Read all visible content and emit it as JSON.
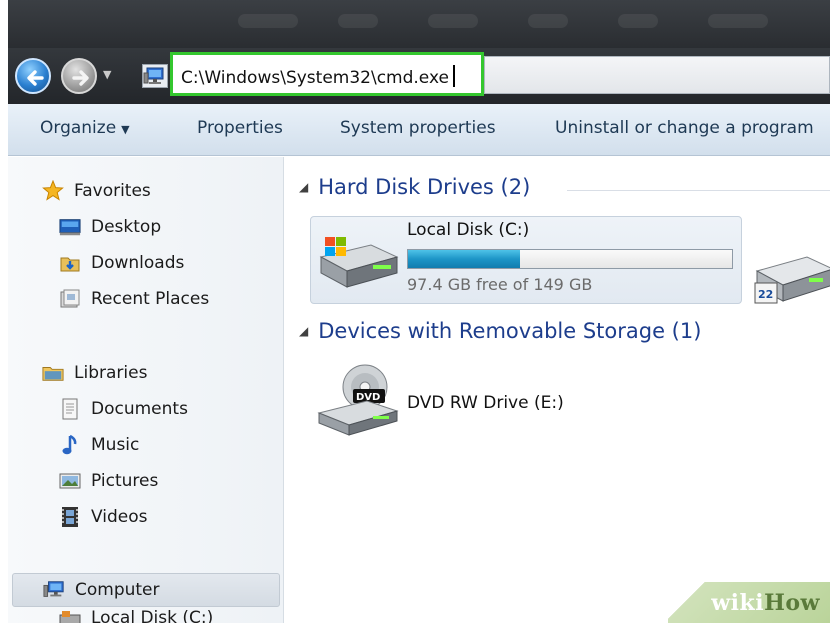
{
  "address_bar": {
    "path": "C:\\Windows\\System32\\cmd.exe",
    "history_arrow": "▼"
  },
  "toolbar": {
    "items": [
      {
        "label": "Organize",
        "dropdown": "▼"
      },
      {
        "label": "Properties"
      },
      {
        "label": "System properties"
      },
      {
        "label": "Uninstall or change a program"
      }
    ]
  },
  "navigation": {
    "favorites": {
      "label": "Favorites",
      "items": [
        {
          "label": "Desktop",
          "icon": "desktop-icon"
        },
        {
          "label": "Downloads",
          "icon": "downloads-icon"
        },
        {
          "label": "Recent Places",
          "icon": "recent-places-icon"
        }
      ]
    },
    "libraries": {
      "label": "Libraries",
      "items": [
        {
          "label": "Documents",
          "icon": "documents-icon"
        },
        {
          "label": "Music",
          "icon": "music-icon"
        },
        {
          "label": "Pictures",
          "icon": "pictures-icon"
        },
        {
          "label": "Videos",
          "icon": "videos-icon"
        }
      ]
    },
    "computer": {
      "label": "Computer",
      "selected": true,
      "child_partial": "Local Disk (C:)"
    }
  },
  "content": {
    "groups": [
      {
        "title": "Hard Disk Drives (2)",
        "drives": [
          {
            "name": "Local Disk (C:)",
            "free_text": "97.4 GB free of 149 GB",
            "used_fraction": 0.346
          }
        ]
      },
      {
        "title": "Devices with Removable Storage (1)",
        "drives": [
          {
            "name": "DVD RW Drive (E:)",
            "badge": "DVD"
          }
        ]
      }
    ]
  },
  "watermark": {
    "prefix": "wiki",
    "suffix": "How"
  },
  "colors": {
    "accent_green": "#34c72e",
    "group_title": "#1d3d8c",
    "progress_fill": "#1d95c7"
  }
}
